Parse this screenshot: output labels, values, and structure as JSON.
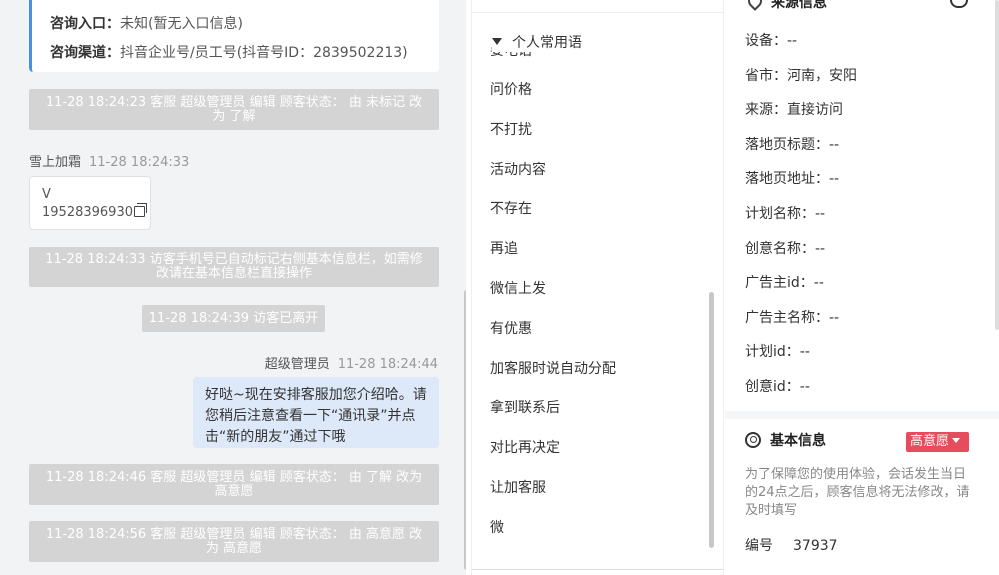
{
  "chat": {
    "consult": {
      "entry_label": "咨询入口：",
      "entry_value": "未知(暂无入口信息)",
      "channel_label": "咨询渠道：",
      "channel_value": "抖音企业号/员工号(抖音号ID：2839502213)"
    },
    "sys1": "11-28 18:24:23 客服 超级管理员 编辑 顾客状态： 由 未标记 改为 了解",
    "visitor_msg": {
      "name": "雪上加霜",
      "time": "11-28 18:24:33",
      "line1": "V",
      "line2": "19528396930"
    },
    "sys2": "11-28 18:24:33 访客手机号已自动标记右侧基本信息栏，如需修改请在基本信息栏直接操作",
    "sys3": "11-28 18:24:39 访客已离开",
    "agent_msg": {
      "name": "超级管理员",
      "time": "11-28 18:24:44",
      "text": "好哒~现在安排客服加您介绍哈。请您稍后注意查看一下“通讯录”并点击“新的朋友”通过下哦"
    },
    "sys4": "11-28 18:24:46 客服 超级管理员 编辑 顾客状态： 由 了解 改为 高意愿",
    "sys5": "11-28 18:24:56 客服 超级管理员 编辑 顾客状态： 由 高意愿 改为 高意愿"
  },
  "phrases": {
    "header": "个人常用语",
    "clipped_item": "要电话",
    "items": [
      "问价格",
      "不打扰",
      "活动内容",
      "不存在",
      "再追",
      "微信上发",
      "有优惠",
      "加客服时说自动分配",
      "拿到联系后",
      "对比再决定",
      "让加客服",
      "微"
    ]
  },
  "info": {
    "source_title": "来源信息",
    "fields": [
      "设备：--",
      "省市：河南，安阳",
      "来源：直接访问",
      "落地页标题：--",
      "落地页地址：--",
      "计划名称：--",
      "创意名称：--",
      "广告主id：--",
      "广告主名称：--",
      "计划id：--",
      "创意id：--"
    ],
    "basic_title": "基本信息",
    "intent_badge": "高意愿",
    "notice": "为了保障您的使用体验，会话发生当日的24点之后，顾客信息将无法修改，请及时填写",
    "serial_label": "编号",
    "serial_value": "37937",
    "colors": {
      "accent_blue": "#4a90e2",
      "badge_red": "#e74c5c",
      "agent_bubble": "#dde8f8",
      "system_msg": "#d4d4d4"
    }
  }
}
